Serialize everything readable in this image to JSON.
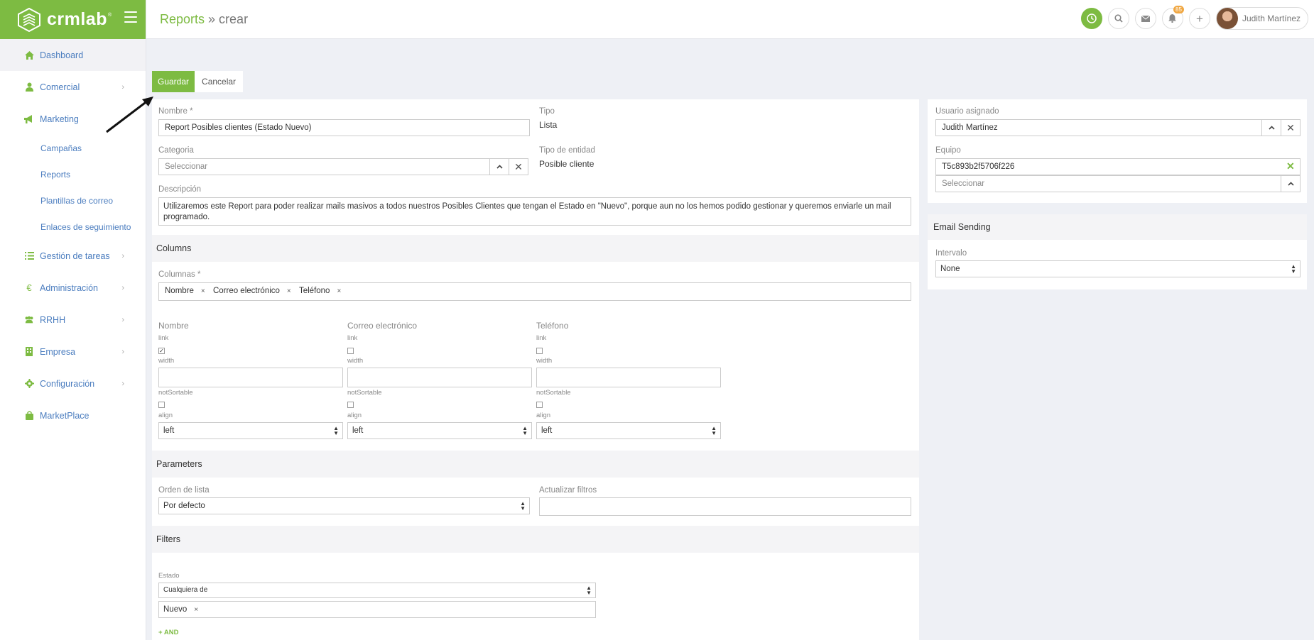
{
  "brand": {
    "name": "crmlab",
    "registered": "®",
    "accent": "#7dbb42",
    "link": "#4b7dbf"
  },
  "sidebar": {
    "items": [
      {
        "label": "Dashboard",
        "icon": "home-icon"
      },
      {
        "label": "Comercial",
        "icon": "user-icon"
      },
      {
        "label": "Marketing",
        "icon": "megaphone-icon"
      },
      {
        "label": "Gestión de tareas",
        "icon": "list-icon"
      },
      {
        "label": "Administración",
        "icon": "euro-icon"
      },
      {
        "label": "RRHH",
        "icon": "users-icon"
      },
      {
        "label": "Empresa",
        "icon": "building-icon"
      },
      {
        "label": "Configuración",
        "icon": "gear-icon"
      },
      {
        "label": "MarketPlace",
        "icon": "bag-icon"
      }
    ],
    "sub_items": [
      "Campañas",
      "Reports",
      "Plantillas de correo",
      "Enlaces de seguimiento"
    ]
  },
  "header": {
    "breadcrumb_link": "Reports",
    "separator": " » ",
    "current": "crear",
    "notifications_count": "85",
    "user_name": "Judith Martínez"
  },
  "actions": {
    "save": "Guardar",
    "cancel": "Cancelar"
  },
  "form": {
    "nombre": {
      "label": "Nombre *",
      "value": "Report Posibles clientes (Estado Nuevo)"
    },
    "tipo": {
      "label": "Tipo",
      "value": "Lista"
    },
    "categoria": {
      "label": "Categoria",
      "placeholder": "Seleccionar"
    },
    "tipo_entidad": {
      "label": "Tipo de entidad",
      "value": "Posible cliente"
    },
    "descripcion": {
      "label": "Descripción",
      "line1": "Utilizaremos este Report para poder realizar mails masivos a todos nuestros Posibles Clientes que tengan el Estado en \"Nuevo\", porque aun no los hemos podido gestionar y queremos enviarle un mail",
      "line2": "programado."
    }
  },
  "columns": {
    "title": "Columns",
    "label": "Columnas *",
    "tags": [
      "Nombre",
      "Correo electrónico",
      "Teléfono"
    ],
    "x": "×",
    "details": [
      {
        "name": "Nombre",
        "link_checked": true
      },
      {
        "name": "Correo electrónico",
        "link_checked": false
      },
      {
        "name": "Teléfono",
        "link_checked": false
      }
    ],
    "link_label": "link",
    "width_label": "width",
    "not_sortable_label": "notSortable",
    "align_label": "align",
    "align_value": "left"
  },
  "parameters": {
    "title": "Parameters",
    "orden_label": "Orden de lista",
    "orden_value": "Por defecto",
    "actualizar_label": "Actualizar filtros"
  },
  "filters": {
    "title": "Filters",
    "estado_label": "Estado",
    "estado_select": "Cualquiera de",
    "estado_tag": "Nuevo",
    "add_and": "AND"
  },
  "assignment": {
    "usuario_label": "Usuario asignado",
    "usuario_value": "Judith Martínez",
    "equipo_label": "Equipo",
    "equipo_value": "T5c893b2f5706f226",
    "equipo_placeholder": "Seleccionar"
  },
  "email_sending": {
    "title": "Email Sending",
    "intervalo_label": "Intervalo",
    "intervalo_value": "None"
  }
}
